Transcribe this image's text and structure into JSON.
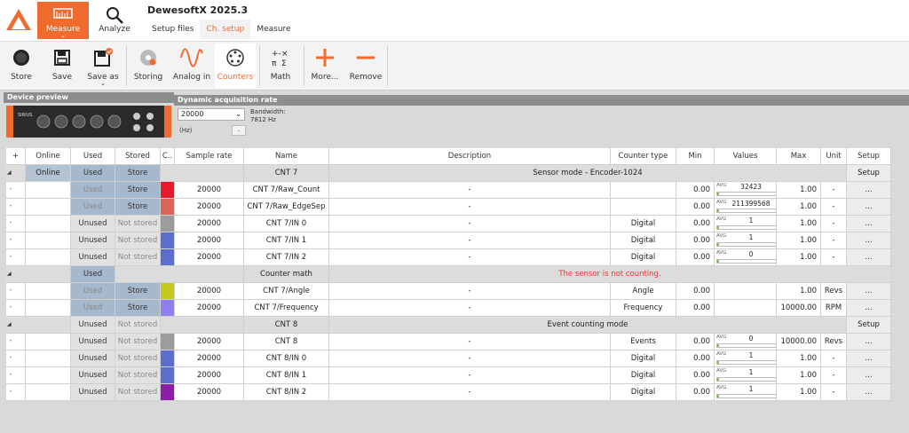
{
  "app": {
    "title": "DewesoftX 2025.3"
  },
  "nav": {
    "measure_label": "Measure",
    "analyze_label": "Analyze",
    "tabs": [
      "Setup files",
      "Ch. setup",
      "Measure"
    ],
    "active_tab": 1
  },
  "toolbar": {
    "store": "Store",
    "save": "Save",
    "save_as": "Save as",
    "storing": "Storing",
    "analog_in": "Analog in",
    "counters": "Counters",
    "math": "Math",
    "more": "More...",
    "remove": "Remove"
  },
  "device_preview": {
    "title": "Device preview",
    "device_brand": "SIRIUS"
  },
  "acquisition": {
    "title": "Dynamic acquisition rate",
    "rate": "20000",
    "bandwidth_label": "Bandwidth:",
    "bandwidth_value": "7812 Hz",
    "unit": "(Hz)",
    "button": "."
  },
  "grid": {
    "headers": [
      "+",
      "Online",
      "Used",
      "Stored",
      "C..",
      "Sample rate",
      "Name",
      "Description",
      "Counter type",
      "Min",
      "Values",
      "Max",
      "Unit",
      "Setup"
    ],
    "groups": [
      {
        "online": "Online",
        "used": "Used",
        "stored": "Store",
        "name": "CNT 7",
        "description": "Sensor mode - Encoder-1024",
        "setup": "Setup"
      },
      {
        "used": "Used",
        "name": "Counter math",
        "description": "The sensor is not counting."
      },
      {
        "used": "Unused",
        "stored": "Not stored",
        "name": "CNT 8",
        "description": "Event counting mode",
        "setup": "Setup"
      }
    ],
    "rows": [
      {
        "used": "Used",
        "stored": "Store",
        "color": "#e8192c",
        "rate": "20000",
        "name": "CNT 7/Raw_Count",
        "desc": "-",
        "type": "",
        "min": "0.00",
        "value": "32423",
        "fill": 0.03,
        "max": "1.00",
        "unit": "-",
        "setup": "..."
      },
      {
        "used": "Used",
        "stored": "Store",
        "color": "#d9645a",
        "rate": "20000",
        "name": "CNT 7/Raw_EdgeSep",
        "desc": "-",
        "type": "",
        "min": "0.00",
        "value": "211399568",
        "fill": 0.03,
        "max": "1.00",
        "unit": "-",
        "setup": "..."
      },
      {
        "used": "Unused",
        "stored": "Not stored",
        "color": "#9c9c9c",
        "rate": "20000",
        "name": "CNT 7/IN 0",
        "desc": "-",
        "type": "Digital",
        "min": "0.00",
        "value": "1",
        "fill": 0.03,
        "max": "1.00",
        "unit": "-",
        "setup": "..."
      },
      {
        "used": "Unused",
        "stored": "Not stored",
        "color": "#5b6ed0",
        "rate": "20000",
        "name": "CNT 7/IN 1",
        "desc": "-",
        "type": "Digital",
        "min": "0.00",
        "value": "1",
        "fill": 0.03,
        "max": "1.00",
        "unit": "-",
        "setup": "..."
      },
      {
        "used": "Unused",
        "stored": "Not stored",
        "color": "#5b6ed0",
        "rate": "20000",
        "name": "CNT 7/IN 2",
        "desc": "-",
        "type": "Digital",
        "min": "0.00",
        "value": "0",
        "fill": 0.03,
        "max": "1.00",
        "unit": "-",
        "setup": "..."
      },
      {
        "used": "Used",
        "stored": "Store",
        "color": "#c6c81e",
        "rate": "20000",
        "name": "CNT 7/Angle",
        "desc": "-",
        "type": "Angle",
        "min": "0.00",
        "value": "",
        "fill": 0,
        "max": "1.00",
        "unit": "Revs",
        "setup": "..."
      },
      {
        "used": "Used",
        "stored": "Store",
        "color": "#8f7ff0",
        "rate": "20000",
        "name": "CNT 7/Frequency",
        "desc": "-",
        "type": "Frequency",
        "min": "0.00",
        "value": "",
        "fill": 0,
        "max": "10000.00",
        "unit": "RPM",
        "setup": "..."
      },
      {
        "used": "Unused",
        "stored": "Not stored",
        "color": "#9c9c9c",
        "rate": "20000",
        "name": "CNT 8",
        "desc": "-",
        "type": "Events",
        "min": "0.00",
        "value": "0",
        "fill": 0.03,
        "max": "10000.00",
        "unit": "Revs",
        "setup": "..."
      },
      {
        "used": "Unused",
        "stored": "Not stored",
        "color": "#5b6ed0",
        "rate": "20000",
        "name": "CNT 8/IN 0",
        "desc": "-",
        "type": "Digital",
        "min": "0.00",
        "value": "1",
        "fill": 0.03,
        "max": "1.00",
        "unit": "-",
        "setup": "..."
      },
      {
        "used": "Unused",
        "stored": "Not stored",
        "color": "#5b6ed0",
        "rate": "20000",
        "name": "CNT 8/IN 1",
        "desc": "-",
        "type": "Digital",
        "min": "0.00",
        "value": "1",
        "fill": 0.03,
        "max": "1.00",
        "unit": "-",
        "setup": "..."
      },
      {
        "used": "Unused",
        "stored": "Not stored",
        "color": "#8c1fa8",
        "rate": "20000",
        "name": "CNT 8/IN 2",
        "desc": "-",
        "type": "Digital",
        "min": "0.00",
        "value": "1",
        "fill": 0.03,
        "max": "1.00",
        "unit": "-",
        "setup": "..."
      }
    ]
  },
  "colors": {
    "accent": "#ef6c2e",
    "used": "#a5b8cc",
    "bar": "#7cc243",
    "warning": "#e53935"
  }
}
